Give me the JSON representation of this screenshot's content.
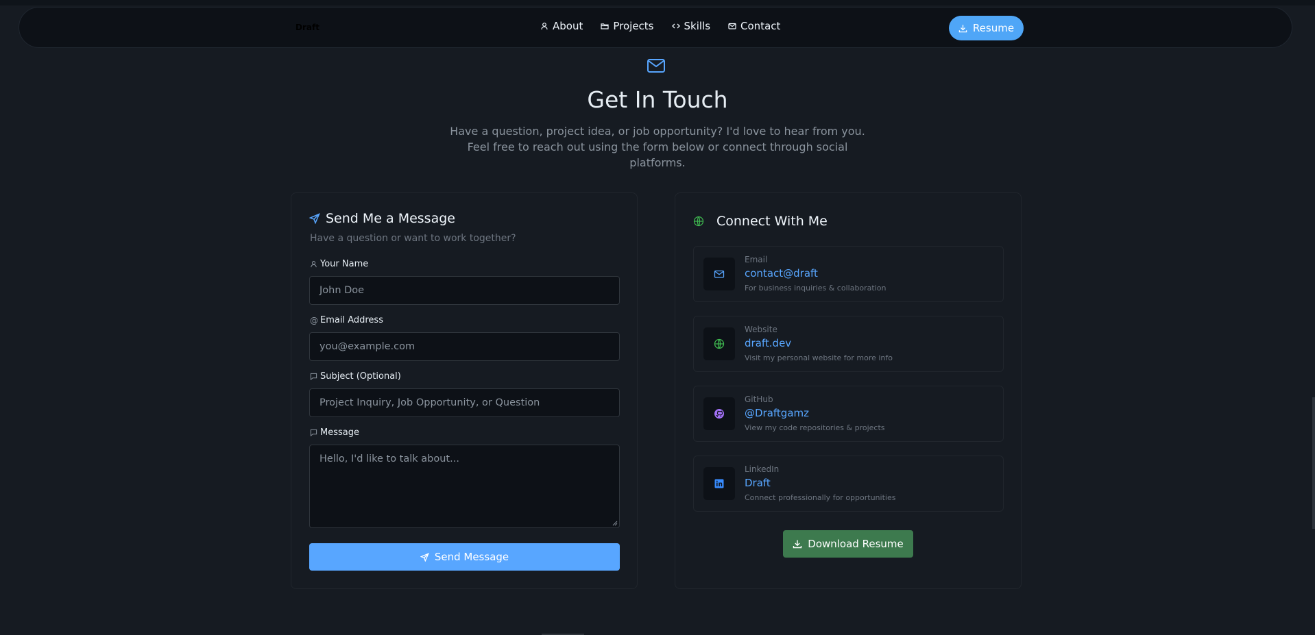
{
  "nav": {
    "logo": "Draft",
    "links": [
      {
        "label": "About",
        "icon": "user-icon"
      },
      {
        "label": "Projects",
        "icon": "folder-icon"
      },
      {
        "label": "Skills",
        "icon": "code-icon"
      },
      {
        "label": "Contact",
        "icon": "mail-icon"
      }
    ],
    "resume_label": "Resume"
  },
  "hero": {
    "title": "Get In Touch",
    "subtitle": "Have a question, project idea, or job opportunity? I'd love to hear from you. Feel free to reach out using the form below or connect through social platforms."
  },
  "form": {
    "title": "Send Me a Message",
    "subtitle": "Have a question or want to work together?",
    "name_label": "Your Name",
    "name_placeholder": "John Doe",
    "email_label": "Email Address",
    "email_placeholder": "you@example.com",
    "subject_label": "Subject (Optional)",
    "subject_placeholder": "Project Inquiry, Job Opportunity, or Question",
    "message_label": "Message",
    "message_placeholder": "Hello, I'd like to talk about...",
    "send_label": "Send Message"
  },
  "connect": {
    "title": "Connect With Me",
    "items": [
      {
        "category": "Email",
        "value": "contact@draft",
        "desc": "For business inquiries & collaboration",
        "icon": "mail-icon",
        "color": "#58a6ff"
      },
      {
        "category": "Website",
        "value": "draft.dev",
        "desc": "Visit my personal website for more info",
        "icon": "globe-icon",
        "color": "#3fb950"
      },
      {
        "category": "GitHub",
        "value": "@Draftgamz",
        "desc": "View my code repositories & projects",
        "icon": "github-icon",
        "color": "#a371f7"
      },
      {
        "category": "LinkedIn",
        "value": "Draft",
        "desc": "Connect professionally for opportunities",
        "icon": "linkedin-icon",
        "color": "#388bfd"
      }
    ],
    "download_label": "Download Resume"
  },
  "colors": {
    "accent": "#58a6ff",
    "success": "#3d7a4e",
    "background": "#161b22",
    "surface": "#0d1117"
  }
}
